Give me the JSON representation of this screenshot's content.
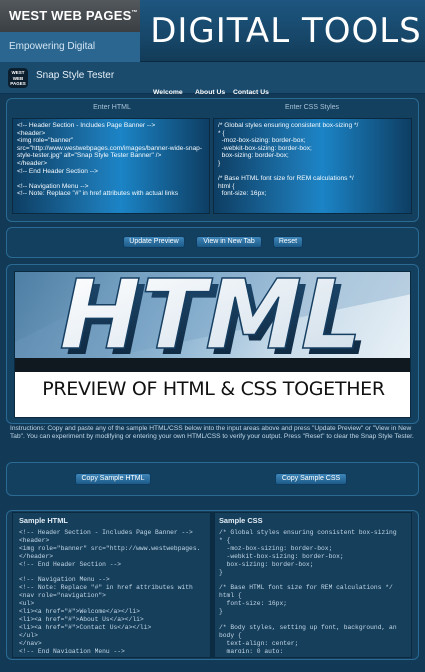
{
  "header": {
    "brand_name": "WEST WEB PAGES",
    "brand_tm": "™",
    "tagline": "Empowering Digital Presence",
    "title": "DIGITAL TOOLS"
  },
  "app": {
    "logo_text": "WEST WEB PAGES",
    "title": "Snap Style Tester"
  },
  "editor": {
    "html_label": "Enter HTML",
    "css_label": "Enter CSS Styles",
    "html_value": "<!-- Header Section - Includes Page Banner -->\n<header>\n<img role=\"banner\" src=\"http://www.westwebpages.com/images/banner-wide-snap-style-tester.jpg\" alt=\"Snap Style Tester Banner\" />\n</header>\n<!-- End Header Section -->\n\n<!-- Navigation Menu -->\n<!-- Note: Replace \"#\" in href attributes with actual links",
    "css_value": "/* Global styles ensuring consistent box-sizing */\n* {\n  -moz-box-sizing: border-box;\n  -webkit-box-sizing: border-box;\n  box-sizing: border-box;\n}\n\n/* Base HTML font size for REM calculations */\nhtml {\n  font-size: 16px;"
  },
  "buttons": {
    "update": "Update Preview",
    "new_tab": "View in New Tab",
    "reset": "Reset",
    "copy_html": "Copy Sample HTML",
    "copy_css": "Copy Sample CSS"
  },
  "preview": {
    "banner_word": "HTML",
    "nav": [
      "Welcome",
      "About Us",
      "Contact Us"
    ],
    "heading": "PREVIEW OF HTML & CSS TOGETHER"
  },
  "instructions": "Instructions: Copy and paste any of the sample HTML/CSS below into the input areas above and press \"Update Preview\" or \"View in New Tab\". You can experiment by modifying or entering your own HTML/CSS to verify your output. Press \"Reset\" to clear the Snap Style Tester.",
  "samples": {
    "html_title": "Sample HTML",
    "css_title": "Sample CSS",
    "html_code": "<!-- Header Section - Includes Page Banner -->\n<header>\n<img role=\"banner\" src=\"http://www.westwebpages.\n</header>\n<!-- End Header Section -->\n\n<!-- Navigation Menu -->\n<!-- Note: Replace \"#\" in href attributes with\n<nav role=\"navigation\">\n<ul>\n<li><a href=\"#\">Welcome</a></li>\n<li><a href=\"#\">About Us</a></li>\n<li><a href=\"#\">Contact Us</a></li>\n</ul>\n</nav>\n<!-- End Navigation Menu -->",
    "css_code": "/* Global styles ensuring consistent box-sizing\n* {\n  -moz-box-sizing: border-box;\n  -webkit-box-sizing: border-box;\n  box-sizing: border-box;\n}\n\n/* Base HTML font size for REM calculations */\nhtml {\n  font-size: 16px;\n}\n\n/* Body styles, setting up font, background, an\nbody {\n  text-align: center;\n  margin: 0 auto;"
  },
  "colors": {
    "page_bg": "#123a57",
    "panel_border": "#2a6a93",
    "button": "#2a6fa1"
  }
}
